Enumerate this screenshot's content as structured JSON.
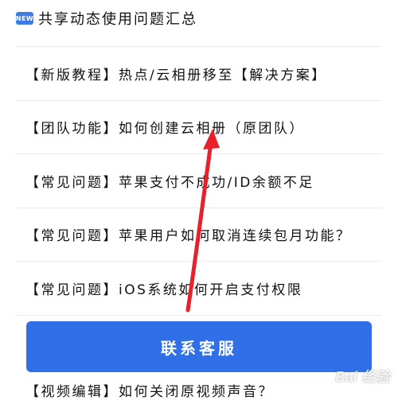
{
  "header": {
    "badge": "NEW",
    "title": "共享动态使用问题汇总"
  },
  "items": [
    {
      "label": "【新版教程】热点/云相册移至【解决方案】"
    },
    {
      "label": "【团队功能】如何创建云相册（原团队）"
    },
    {
      "label": "【常见问题】苹果支付不成功/ID余额不足"
    },
    {
      "label": "【常见问题】苹果用户如何取消连续包月功能？"
    },
    {
      "label": "【常见问题】iOS系统如何开启支付权限"
    }
  ],
  "contact_button": {
    "label": "联系客服"
  },
  "bottom_item": {
    "label": "【视频编辑】如何关闭原视频声音？"
  },
  "watermark": {
    "text": "Bai 经验"
  },
  "colors": {
    "accent": "#2f6fe8",
    "annotation": "#e8202a"
  }
}
